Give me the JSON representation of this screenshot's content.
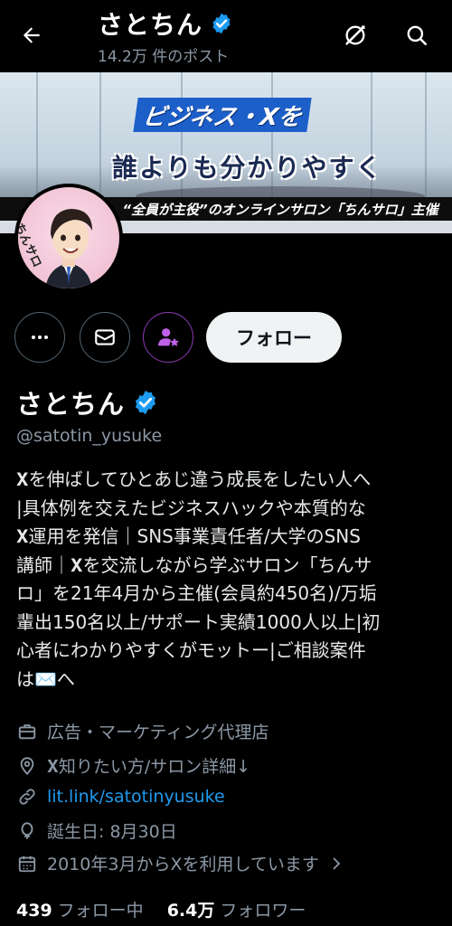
{
  "header": {
    "title": "さとちん",
    "post_count": "14.2万 件のポスト"
  },
  "banner": {
    "headline": "ビジネス・Xを",
    "subheadline": "誰よりも分かりやすく",
    "strip_text": "“全員が主役”のオンラインサロン「ちんサロ」主催"
  },
  "avatar": {
    "badge_text": "ちんサロ"
  },
  "actions": {
    "follow_label": "フォロー"
  },
  "profile": {
    "display_name": "さとちん",
    "handle": "@satotin_yusuke",
    "bio": "𝐗を伸ばしてひとあじ違う成長をしたい人へ\n|具体例を交えたビジネスハックや本質的な\n𝐗運用を発信｜SNS事業責任者/大学のSNS\n講師｜𝐗を交流しながら学ぶサロン「ちんサ\nロ」を21年4月から主催(会員約450名)/万垢\n輩出150名以上/サポート実績1000人以上|初\n心者にわかりやすくがモットー|ご相談案件\nは✉️へ",
    "category": "広告・マーケティング代理店",
    "location": "𝐗知りたい方/サロン詳細↓",
    "website": "lit.link/satotinyusuke",
    "birthday": "誕生日: 8月30日",
    "joined": "2010年3月からXを利用しています",
    "following_count": "439",
    "following_label": "フォロー中",
    "followers_count": "6.4万",
    "followers_label": "フォロワー"
  },
  "colors": {
    "background": "#000000",
    "text": "#e7e9ea",
    "muted": "#8b98a5",
    "link": "#1d9bf0",
    "verified": "#1d9bf0",
    "subscribe_accent": "#8e3bb6"
  },
  "icons": {
    "back": "arrow-left-icon",
    "grok": "grok-icon",
    "search": "search-icon",
    "more": "more-icon",
    "message": "envelope-icon",
    "subscribe": "person-star-icon",
    "category": "briefcase-icon",
    "location": "location-pin-icon",
    "website": "link-icon",
    "birthday": "balloon-icon",
    "joined": "calendar-icon"
  }
}
